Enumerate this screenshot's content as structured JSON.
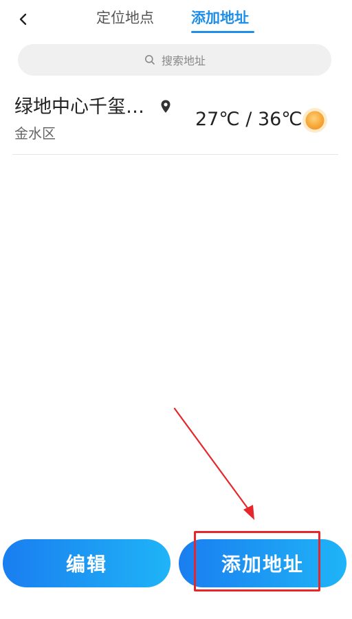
{
  "header": {
    "tabs": [
      {
        "label": "定位地点",
        "active": false
      },
      {
        "label": "添加地址",
        "active": true
      }
    ]
  },
  "search": {
    "placeholder": "搜索地址"
  },
  "location": {
    "name": "绿地中心千玺…",
    "district": "金水区",
    "temperature": "27℃ / 36℃"
  },
  "buttons": {
    "edit_label": "编辑",
    "add_label": "添加地址"
  },
  "colors": {
    "accent": "#1e8ee8",
    "button_gradient_start": "#1a7ef0",
    "button_gradient_end": "#1fb4f7",
    "annotation": "#e6262b"
  },
  "icons": {
    "back": "back-arrow-icon",
    "search": "search-icon",
    "location": "location-pin-icon",
    "weather": "sun-icon"
  }
}
